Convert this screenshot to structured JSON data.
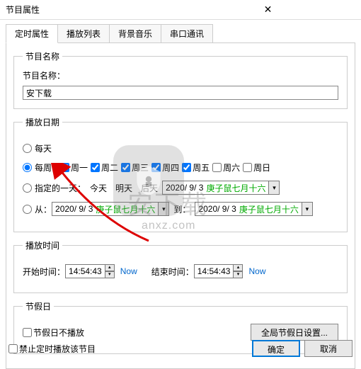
{
  "window": {
    "title": "节目属性",
    "close": "✕"
  },
  "tabs": {
    "t0": "定时属性",
    "t1": "播放列表",
    "t2": "背景音乐",
    "t3": "串口通讯"
  },
  "section_name": {
    "legend": "节目名称",
    "label": "节目名称：",
    "value": "安下载"
  },
  "section_date": {
    "legend": "播放日期",
    "daily": "每天",
    "weekly": "每周：",
    "days": {
      "d1": "周一",
      "d2": "周二",
      "d3": "周三",
      "d4": "周四",
      "d5": "周五",
      "d6": "周六",
      "d7": "周日"
    },
    "specific": "指定的一天：",
    "today": "今天",
    "tomorrow": "明天",
    "dayafter": "后天",
    "date1": "2020/ 9/ 3",
    "lunar1": "庚子鼠七月十六",
    "from": "从：",
    "to": "到：",
    "date_from": "2020/ 9/ 3",
    "lunar_from": "庚子鼠七月十六",
    "date_to": "2020/ 9/ 3",
    "lunar_to": "庚子鼠七月十六"
  },
  "section_time": {
    "legend": "播放时间",
    "start_label": "开始时间：",
    "start_value": "14:54:43",
    "end_label": "结束时间：",
    "end_value": "14:54:43",
    "now": "Now"
  },
  "section_holiday": {
    "legend": "节假日",
    "skip": "节假日不播放",
    "global": "全局节假日设置..."
  },
  "footer": {
    "forbid": "禁止定时播放该节目",
    "ok": "确定",
    "cancel": "取消"
  },
  "overlay": {
    "brand": "安下载",
    "url": "anxz.com"
  }
}
